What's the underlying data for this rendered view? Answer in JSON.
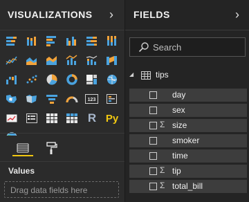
{
  "visualizations": {
    "title": "VISUALIZATIONS",
    "collapse_icon": "chevron-right-icon",
    "icons": [
      "stacked-bar-chart-icon",
      "stacked-column-chart-icon",
      "clustered-bar-chart-icon",
      "clustered-column-chart-icon",
      "100-stacked-bar-chart-icon",
      "100-stacked-column-chart-icon",
      "line-chart-icon",
      "area-chart-icon",
      "stacked-area-chart-icon",
      "line-and-column-chart-icon",
      "line-and-stacked-column-chart-icon",
      "ribbon-chart-icon",
      "waterfall-chart-icon",
      "scatter-chart-icon",
      "pie-chart-icon",
      "donut-chart-icon",
      "treemap-icon",
      "map-icon",
      "filled-map-icon",
      "shape-map-icon",
      "funnel-icon",
      "gauge-icon",
      "card-icon",
      "multi-row-card-icon",
      "kpi-icon",
      "slicer-icon",
      "table-icon",
      "matrix-icon",
      "r-visual-icon",
      "python-visual-icon",
      "arcgis-map-icon",
      "more-icon"
    ],
    "r_label": "R",
    "py_label": "Py",
    "more_label": "···",
    "tabs": [
      {
        "icon": "fields-tab-icon"
      },
      {
        "icon": "format-paint-roller-icon"
      }
    ],
    "values_label": "Values",
    "drop_placeholder": "Drag data fields here"
  },
  "fields": {
    "title": "FIELDS",
    "collapse_icon": "chevron-right-icon",
    "search_placeholder": "Search",
    "table_name": "tips",
    "table_icon": "table-icon",
    "items": [
      {
        "name": "day",
        "sigma": ""
      },
      {
        "name": "sex",
        "sigma": ""
      },
      {
        "name": "size",
        "sigma": "Σ"
      },
      {
        "name": "smoker",
        "sigma": ""
      },
      {
        "name": "time",
        "sigma": ""
      },
      {
        "name": "tip",
        "sigma": "Σ"
      },
      {
        "name": "total_bill",
        "sigma": "Σ"
      }
    ]
  },
  "colors": {
    "accent_blue": "#4aa3df",
    "accent_orange": "#f2a33a",
    "accent_yellow": "#f2c811"
  }
}
